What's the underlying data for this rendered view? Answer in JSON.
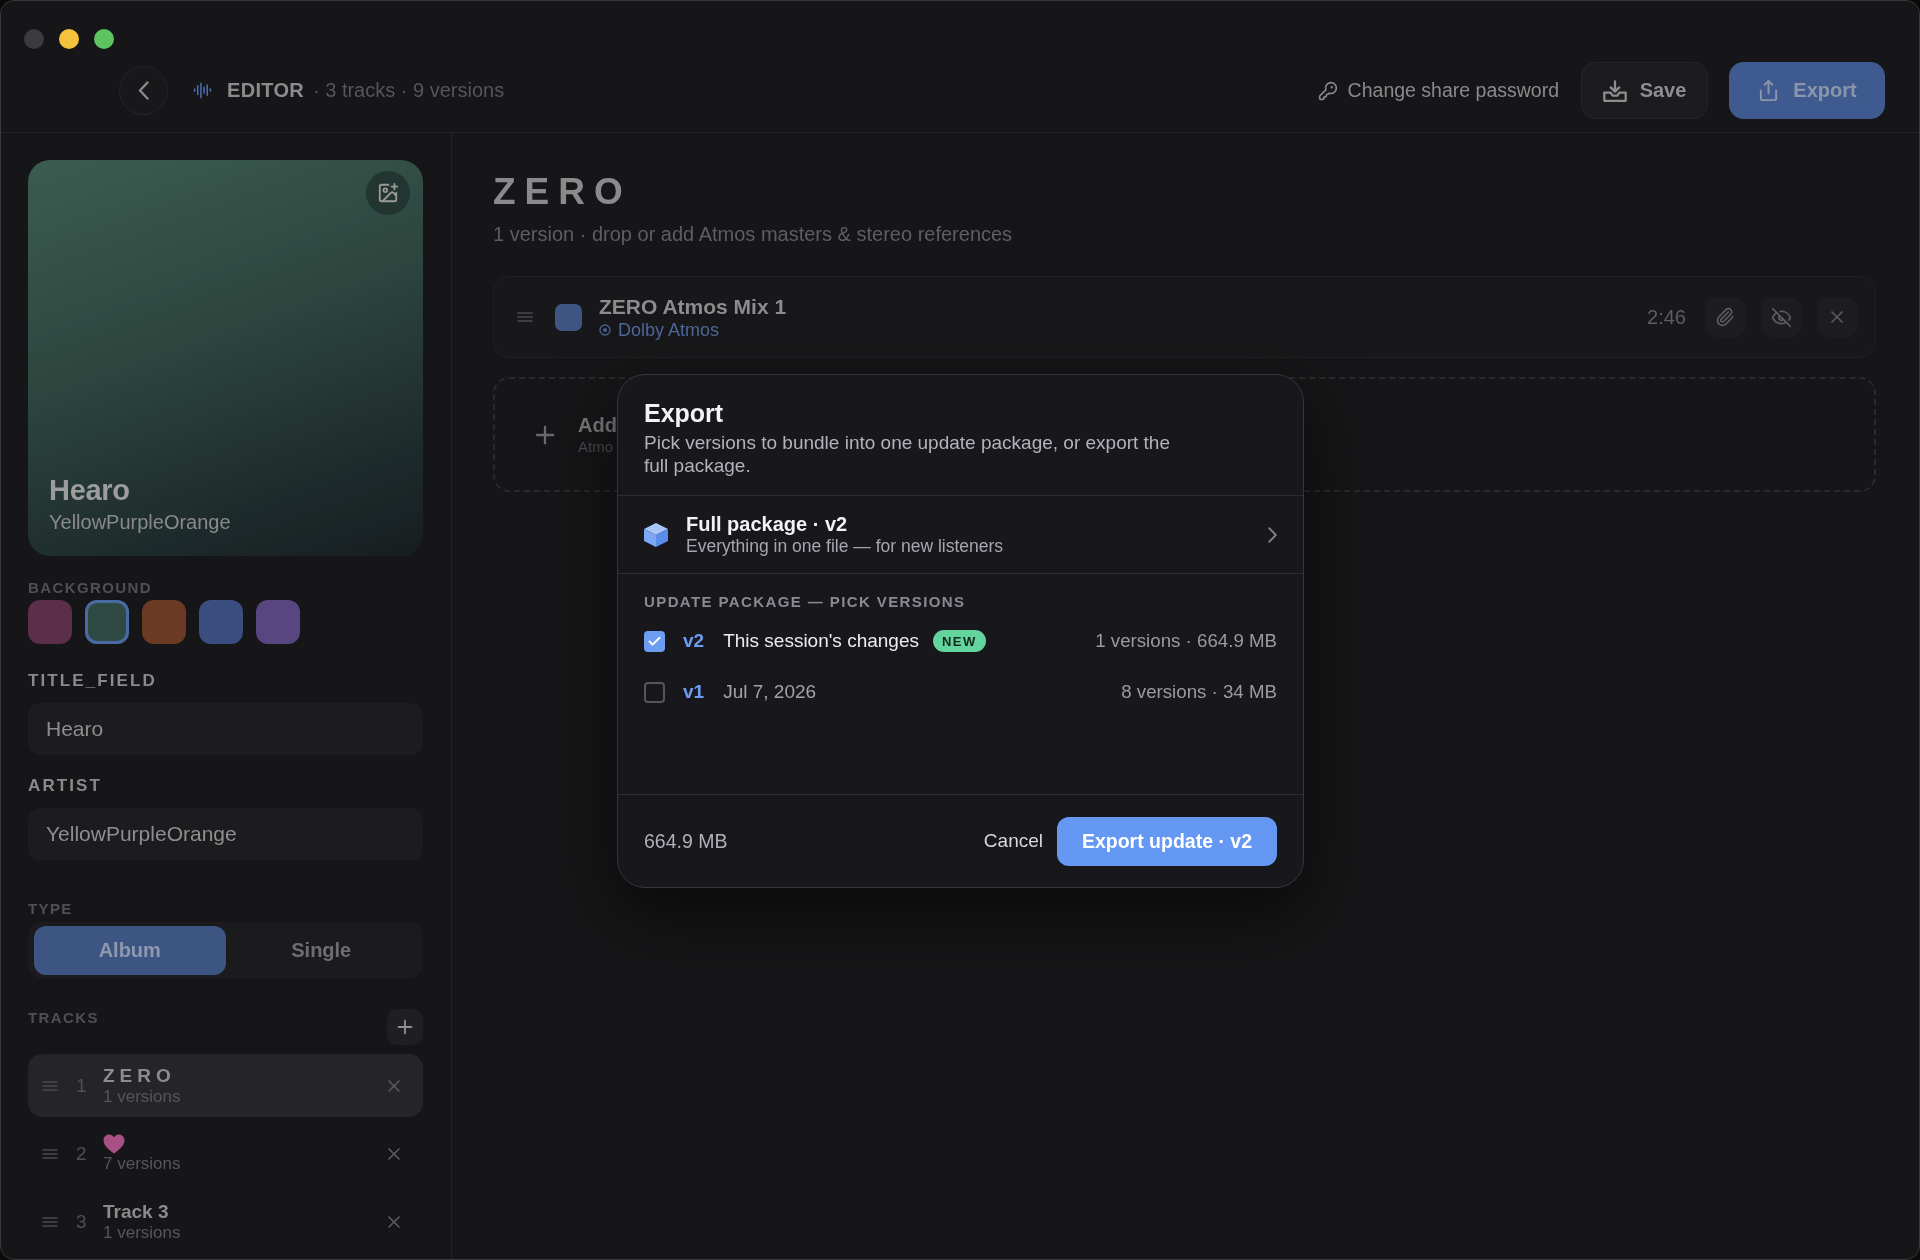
{
  "toolbar": {
    "title": "EDITOR",
    "summary": "· 3 tracks · 9 versions",
    "share_password": "Change share password",
    "save": "Save",
    "export": "Export"
  },
  "cover": {
    "title": "Hearo",
    "artist": "YellowPurpleOrange"
  },
  "background": {
    "label": "BACKGROUND",
    "swatches": [
      {
        "color": "#5b2e49",
        "selected": false
      },
      {
        "color": "#2e4a42",
        "selected": true
      },
      {
        "color": "#6a3a24",
        "selected": false
      },
      {
        "color": "#3a4e80",
        "selected": false
      },
      {
        "color": "#574680",
        "selected": false
      }
    ]
  },
  "fields": [
    {
      "label": "TITLE_FIELD",
      "value": "Hearo"
    },
    {
      "label": "ARTIST",
      "value": "YellowPurpleOrange"
    }
  ],
  "type": {
    "label": "TYPE",
    "options": [
      {
        "label": "Album",
        "selected": true
      },
      {
        "label": "Single",
        "selected": false
      }
    ]
  },
  "tracks": {
    "label": "TRACKS",
    "items": [
      {
        "number": "1",
        "kind": "spaced",
        "title": "ZERO",
        "versions": "1 versions",
        "selected": true
      },
      {
        "number": "2",
        "kind": "emoji",
        "versions": "7 versions",
        "selected": false
      },
      {
        "number": "3",
        "kind": "plain",
        "title": "Track 3",
        "versions": "1 versions",
        "selected": false
      }
    ]
  },
  "main": {
    "title": "ZERO",
    "subtitle": "1 version · drop or add Atmos masters & stereo references",
    "versions": [
      {
        "name": "ZERO Atmos Mix 1",
        "format": "Dolby Atmos",
        "duration": "2:46",
        "color": "#3e5583"
      }
    ],
    "add": {
      "title": "Add",
      "subtitle": "Atmo"
    }
  },
  "export_dialog": {
    "title": "Export",
    "description": "Pick versions to bundle into one update package, or export the full package.",
    "full_package": {
      "title": "Full package · v2",
      "subtitle": "Everything in one file — for new listeners"
    },
    "section_label": "UPDATE PACKAGE — PICK VERSIONS",
    "versions": [
      {
        "tag": "v2",
        "label": "This session's changes",
        "badge": "NEW",
        "details": "1 versions · 664.9 MB",
        "checked": true
      },
      {
        "tag": "v1",
        "label": "Jul 7, 2026",
        "details": "8 versions · 34 MB",
        "checked": false
      }
    ],
    "total": "664.9 MB",
    "cancel": "Cancel",
    "confirm": "Export update · v2"
  }
}
